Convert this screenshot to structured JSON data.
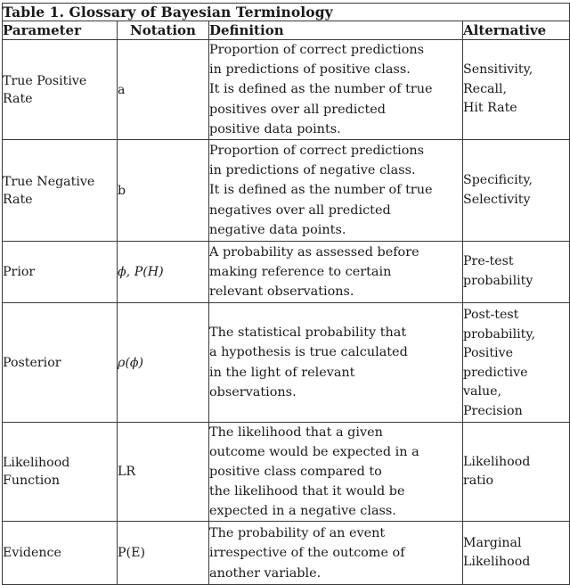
{
  "table": {
    "title": "Table 1.  Glossary of Bayesian Terminology",
    "columns": [
      {
        "key": "parameter",
        "label": "Parameter",
        "align": "left"
      },
      {
        "key": "notation",
        "label": "Notation",
        "align": "center"
      },
      {
        "key": "definition",
        "label": "Definition",
        "align": "left"
      },
      {
        "key": "alternative",
        "label": "Alternative",
        "align": "left"
      }
    ],
    "rows": [
      {
        "parameter": "True Positive\nRate",
        "notation": "a",
        "definition": "Proportion of correct predictions\nin predictions of positive class.\nIt is defined as the number of true\npositives over all predicted\npositive data points.",
        "alternative": "Sensitivity,\nRecall,\nHit Rate"
      },
      {
        "parameter": "True Negative\nRate",
        "notation": "b",
        "definition": "Proportion of correct predictions\nin predictions of negative class.\nIt is defined as the number of true\nnegatives over all predicted\nnegative data points.",
        "alternative": "Specificity,\nSelectivity"
      },
      {
        "parameter": "Prior",
        "notation": "ϕ, P(H)",
        "definition": "A probability as assessed before\nmaking reference to certain\nrelevant observations.",
        "alternative": "Pre-test\nprobability"
      },
      {
        "parameter": "Posterior",
        "notation": "ρ(ϕ)",
        "definition": "The statistical probability that\na hypothesis is true calculated\nin the light of relevant\nobservations.",
        "alternative": "Post-test\nprobability,\nPositive\npredictive\nvalue,\nPrecision"
      },
      {
        "parameter": "Likelihood\nFunction",
        "notation": "LR",
        "definition": "The likelihood that a given\noutcome would be expected in a\npositive class compared to\nthe likelihood that it would be\nexpected in a negative class.",
        "alternative": "Likelihood\nratio"
      },
      {
        "parameter": "Evidence",
        "notation": "P(E)",
        "definition": "The probability of an event\nirrespective of the outcome of\nanother variable.",
        "alternative": "Marginal\nLikelihood"
      }
    ]
  },
  "style": {
    "border_color": "#3a3a3a",
    "text_color": "#1a1a1a",
    "background": "#ffffff"
  }
}
